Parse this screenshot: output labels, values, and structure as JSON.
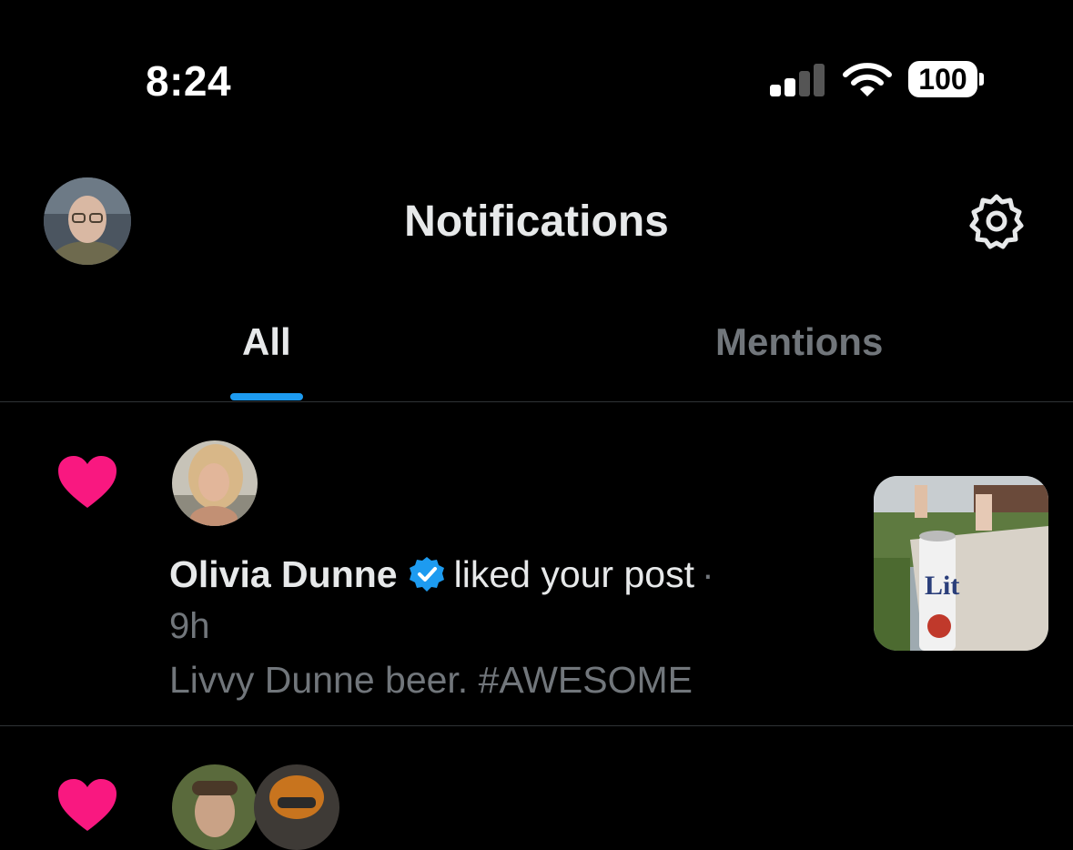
{
  "status_bar": {
    "time": "8:24",
    "battery": "100",
    "icons": [
      "cellular-signal-icon",
      "wifi-icon",
      "battery-icon"
    ]
  },
  "header": {
    "title": "Notifications",
    "avatar": "profile-avatar",
    "settings_icon": "gear-icon"
  },
  "tabs": [
    {
      "label": "All",
      "active": true
    },
    {
      "label": "Mentions",
      "active": false
    }
  ],
  "notifications": [
    {
      "type_icon": "heart-icon",
      "user": "Olivia Dunne",
      "verified": true,
      "action": "liked your post",
      "separator": "·",
      "time_ago": "9h",
      "post_text": "Livvy Dunne beer. #AWESOME",
      "thumbnail": "post-thumbnail"
    },
    {
      "type_icon": "heart-icon"
    }
  ],
  "colors": {
    "background": "#000000",
    "primary_text": "#e7e9ea",
    "secondary_text": "#71767b",
    "accent": "#1d9bf0",
    "like": "#f91880",
    "divider": "#2f3336"
  }
}
